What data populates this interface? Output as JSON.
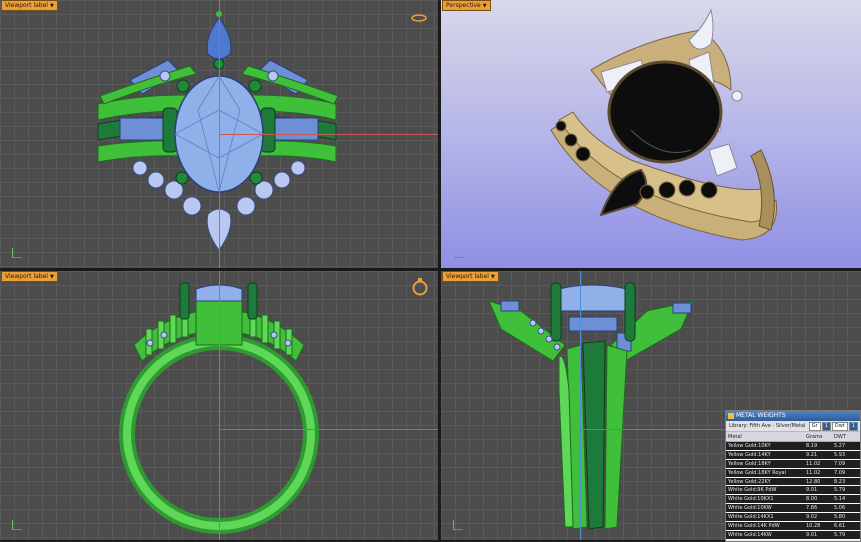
{
  "viewports": {
    "top_left": {
      "label": "Viewport label"
    },
    "top_right": {
      "label": "Perspective"
    },
    "bottom_left": {
      "label": "Viewport label"
    },
    "bottom_right": {
      "label": "Viewport label"
    }
  },
  "colors": {
    "grid_bg": "#4c4c4c",
    "grid_line": "#5a5a5a",
    "perspective_bg": "#a9a9e8",
    "tab_orange": "#e8a03a",
    "metal_green": "#3fbf3a",
    "metal_dark_green": "#1e7a3a",
    "stone_blue": "#7fa6e0",
    "gold": "#c9b07a",
    "onyx": "#0d0d0d",
    "panel_title_blue": "#2d5b9c"
  },
  "metal_weights": {
    "title": "METAL WEIGHTS",
    "library": "Library: Fifth Ave - Silver/Metal",
    "controls": [
      "Gr",
      "1",
      "Dwt",
      "1"
    ],
    "columns": [
      "Metal",
      "Grams",
      "DWT"
    ],
    "rows": [
      {
        "metal": "Yellow Gold:10KY",
        "grams": "8.19",
        "dwt": "5.27"
      },
      {
        "metal": "Yellow Gold:14KY",
        "grams": "9.21",
        "dwt": "5.93"
      },
      {
        "metal": "Yellow Gold:18KY",
        "grams": "11.02",
        "dwt": "7.09"
      },
      {
        "metal": "Yellow Gold:18KY Royal",
        "grams": "11.02",
        "dwt": "7.09"
      },
      {
        "metal": "Yellow Gold:22KY",
        "grams": "12.80",
        "dwt": "8.23"
      },
      {
        "metal": "White Gold:9K PdW",
        "grams": "9.01",
        "dwt": "5.79"
      },
      {
        "metal": "White Gold:10KX1",
        "grams": "8.00",
        "dwt": "5.14"
      },
      {
        "metal": "White Gold:10KW",
        "grams": "7.86",
        "dwt": "5.06"
      },
      {
        "metal": "White Gold:14KX1",
        "grams": "9.02",
        "dwt": "5.80"
      },
      {
        "metal": "White Gold:14K PdW",
        "grams": "10.28",
        "dwt": "6.61"
      },
      {
        "metal": "White Gold:14KW",
        "grams": "9.01",
        "dwt": "5.79"
      }
    ]
  }
}
